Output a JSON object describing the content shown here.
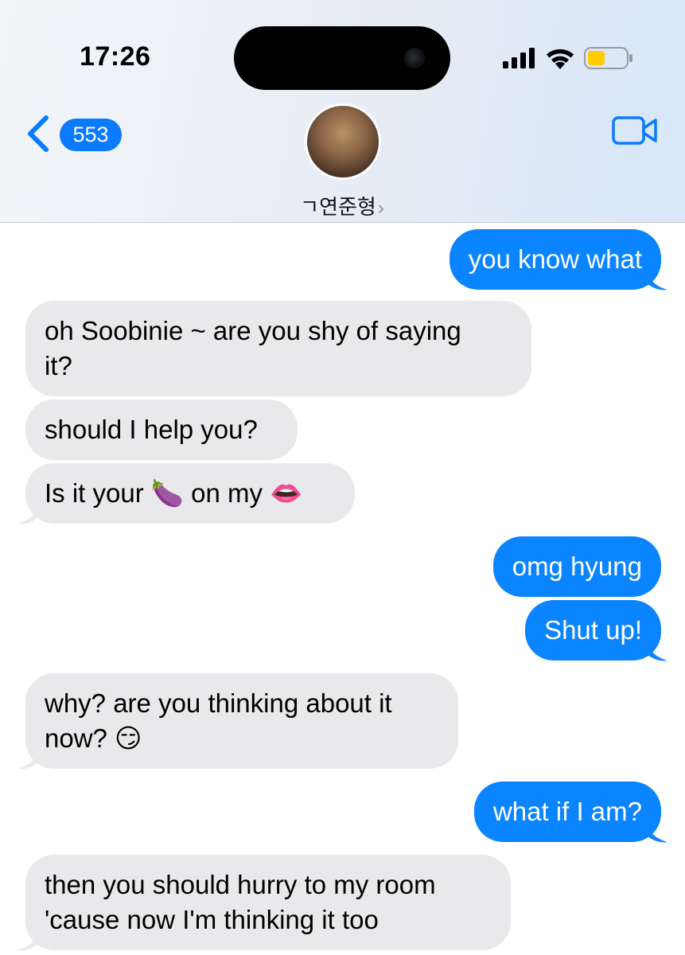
{
  "status_bar": {
    "time": "17:26",
    "signal_bars": 4,
    "wifi": "wifi-icon",
    "battery_level": 0.45,
    "battery_color": "#ffcc00"
  },
  "nav": {
    "back_count": "553",
    "contact_name": "ㄱ연준형",
    "contact_chevron": "›",
    "video_icon": "video-camera-icon",
    "accent": "#0a7aff"
  },
  "messages": [
    {
      "dir": "sent",
      "text": "you know what"
    },
    {
      "dir": "received",
      "text": "oh Soobinie ~ are you shy of saying\nit?"
    },
    {
      "dir": "received",
      "text": "should I help you?"
    },
    {
      "dir": "received",
      "text": "Is it your 🍆 on my 👄"
    },
    {
      "dir": "sent",
      "text": "omg hyung"
    },
    {
      "dir": "sent",
      "text": "Shut up!"
    },
    {
      "dir": "received",
      "text": "why? are you thinking about it\nnow? 😏"
    },
    {
      "dir": "sent",
      "text": "what if I am?"
    },
    {
      "dir": "received",
      "text": "then you should hurry to my room\n'cause now I'm thinking it too"
    }
  ],
  "colors": {
    "sent_bubble": "#0a84ff",
    "received_bubble": "#e9e9eb"
  }
}
